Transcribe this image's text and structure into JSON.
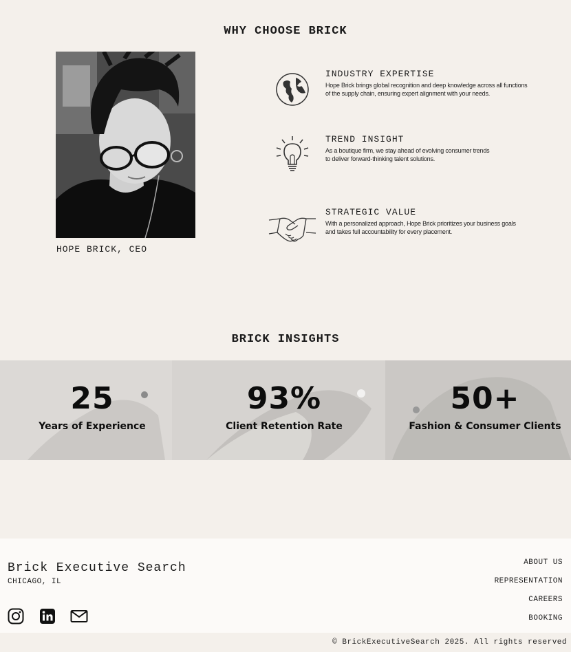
{
  "why": {
    "title": "WHY CHOOSE BRICK",
    "caption": "HOPE BRICK, CEO",
    "features": [
      {
        "title": "INDUSTRY EXPERTISE",
        "line1": "Hope Brick brings global recognition and deep knowledge across all functions",
        "line2": "of the supply chain, ensuring expert alignment with your needs.",
        "icon": "globe-icon"
      },
      {
        "title": "TREND INSIGHT",
        "line1": "As a boutique firm, we stay ahead of evolving consumer trends",
        "line2": "to deliver forward-thinking talent solutions.",
        "icon": "lightbulb-icon"
      },
      {
        "title": "STRATEGIC VALUE",
        "line1": "With a personalized approach, Hope Brick prioritizes your business goals",
        "line2": "and takes full accountability for every placement.",
        "icon": "handshake-icon"
      }
    ]
  },
  "insights": {
    "title": "BRICK INSIGHTS",
    "stats": [
      {
        "value": "25",
        "label": "Years of Experience"
      },
      {
        "value": "93%",
        "label": "Client Retention Rate"
      },
      {
        "value": "50+",
        "label": "Fashion & Consumer Clients"
      }
    ]
  },
  "footer": {
    "brand": "Brick Executive Search",
    "city": "CHICAGO, IL",
    "nav": [
      "ABOUT US",
      "REPRESENTATION",
      "CAREERS",
      "BOOKING"
    ],
    "social": [
      "instagram-icon",
      "linkedin-icon",
      "mail-icon"
    ],
    "copyright": "© BrickExecutiveSearch 2025. All rights reserved"
  }
}
